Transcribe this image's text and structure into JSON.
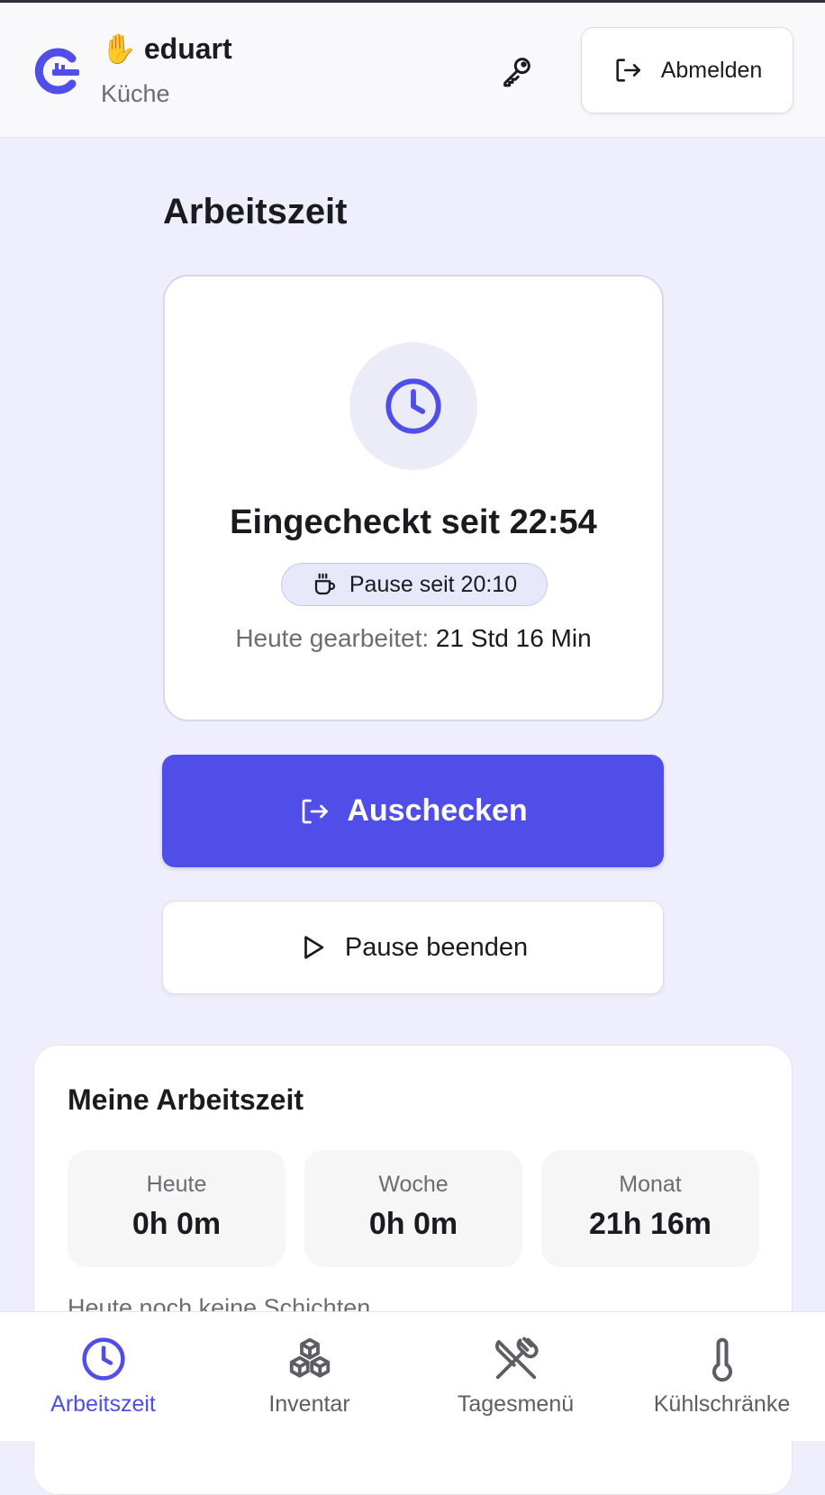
{
  "header": {
    "user_name": "eduart",
    "department": "Küche",
    "logout_label": "Abmelden"
  },
  "page": {
    "title": "Arbeitszeit"
  },
  "status_card": {
    "checked_in_text": "Eingecheckt seit 22:54",
    "pause_text": "Pause seit 20:10",
    "worked_label": "Heute gearbeitet:",
    "worked_value": "21 Std 16 Min"
  },
  "actions": {
    "checkout_label": "Auschecken",
    "end_pause_label": "Pause beenden"
  },
  "summary": {
    "title": "Meine Arbeitszeit",
    "stats": [
      {
        "label": "Heute",
        "value": "0h 0m"
      },
      {
        "label": "Woche",
        "value": "0h 0m"
      },
      {
        "label": "Monat",
        "value": "21h 16m"
      }
    ],
    "no_shifts_text": "Heute noch keine Schichten"
  },
  "bottom_nav": {
    "items": [
      {
        "label": "Arbeitszeit",
        "icon": "clock-icon",
        "active": true
      },
      {
        "label": "Inventar",
        "icon": "boxes-icon",
        "active": false
      },
      {
        "label": "Tagesmenü",
        "icon": "utensils-crossed-icon",
        "active": false
      },
      {
        "label": "Kühlschränke",
        "icon": "thermometer-icon",
        "active": false
      }
    ]
  },
  "colors": {
    "accent": "#4f4ee8",
    "background": "#eeeefc",
    "card": "#ffffff"
  }
}
